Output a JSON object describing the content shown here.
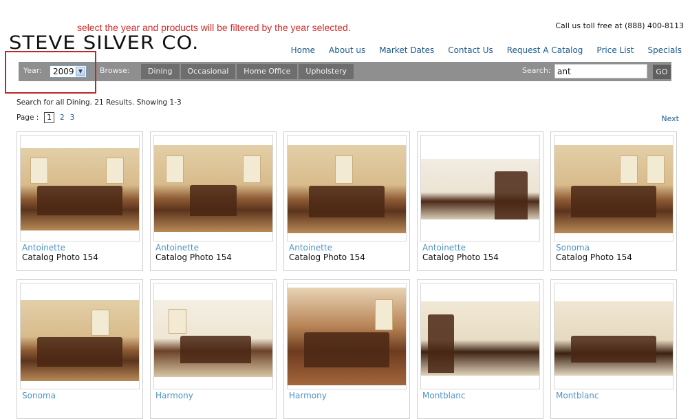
{
  "annotation": {
    "text": "select the year and products will be filtered by the year selected."
  },
  "header": {
    "logo": "STEVE SILVER CO.",
    "toll_free": "Call us toll free at (888) 400-8113",
    "nav": [
      "Home",
      "About us",
      "Market Dates",
      "Contact Us",
      "Request A Catalog",
      "Price List",
      "Specials"
    ]
  },
  "filter_bar": {
    "year_label": "Year:",
    "year_value": "2009",
    "browse_label": "Browse:",
    "tabs": [
      "Dining",
      "Occasional",
      "Home Office",
      "Upholstery"
    ],
    "search_label": "Search:",
    "search_value": "ant",
    "go_label": "GO"
  },
  "results": {
    "summary": "Search for all Dining. 21 Results. Showing 1-3",
    "page_label": "Page :",
    "pages": [
      "1",
      "2",
      "3"
    ],
    "current_page": "1",
    "next_label": "Next"
  },
  "products": [
    {
      "name": "Antoinette",
      "caption": "Catalog Photo 154"
    },
    {
      "name": "Antoinette",
      "caption": "Catalog Photo 154"
    },
    {
      "name": "Antoinette",
      "caption": "Catalog Photo 154"
    },
    {
      "name": "Antoinette",
      "caption": "Catalog Photo 154"
    },
    {
      "name": "Sonoma",
      "caption": "Catalog Photo 154"
    },
    {
      "name": "Sonoma",
      "caption": ""
    },
    {
      "name": "Harmony",
      "caption": ""
    },
    {
      "name": "Harmony",
      "caption": ""
    },
    {
      "name": "Montblanc",
      "caption": ""
    },
    {
      "name": "Montblanc",
      "caption": ""
    }
  ],
  "colors": {
    "link": "#1c5b8e",
    "product_name": "#4f94c4",
    "annotation": "#d42a2a",
    "bar": "#8f8f8f"
  }
}
